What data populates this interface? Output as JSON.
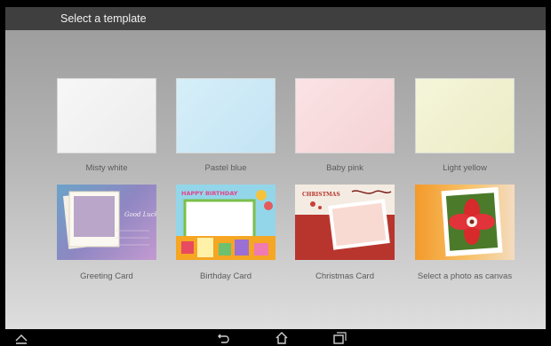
{
  "header": {
    "title": "Select a template"
  },
  "templates": [
    {
      "label": "Misty white",
      "color": "#f3f3f3"
    },
    {
      "label": "Pastel blue",
      "color": "#cde9f6"
    },
    {
      "label": "Baby pink",
      "color": "#f8dadc"
    },
    {
      "label": "Light yellow",
      "color": "#f1f1cf"
    },
    {
      "label": "Greeting Card",
      "art_text": "Good Luck"
    },
    {
      "label": "Birthday Card",
      "art_text": "HAPPY BIRTHDAY"
    },
    {
      "label": "Christmas Card",
      "art_text": "CHRISTMAS"
    },
    {
      "label": "Select a photo as canvas"
    }
  ],
  "navbar": {
    "icons": [
      "collapse-icon",
      "back-icon",
      "home-icon",
      "recent-apps-icon"
    ]
  }
}
